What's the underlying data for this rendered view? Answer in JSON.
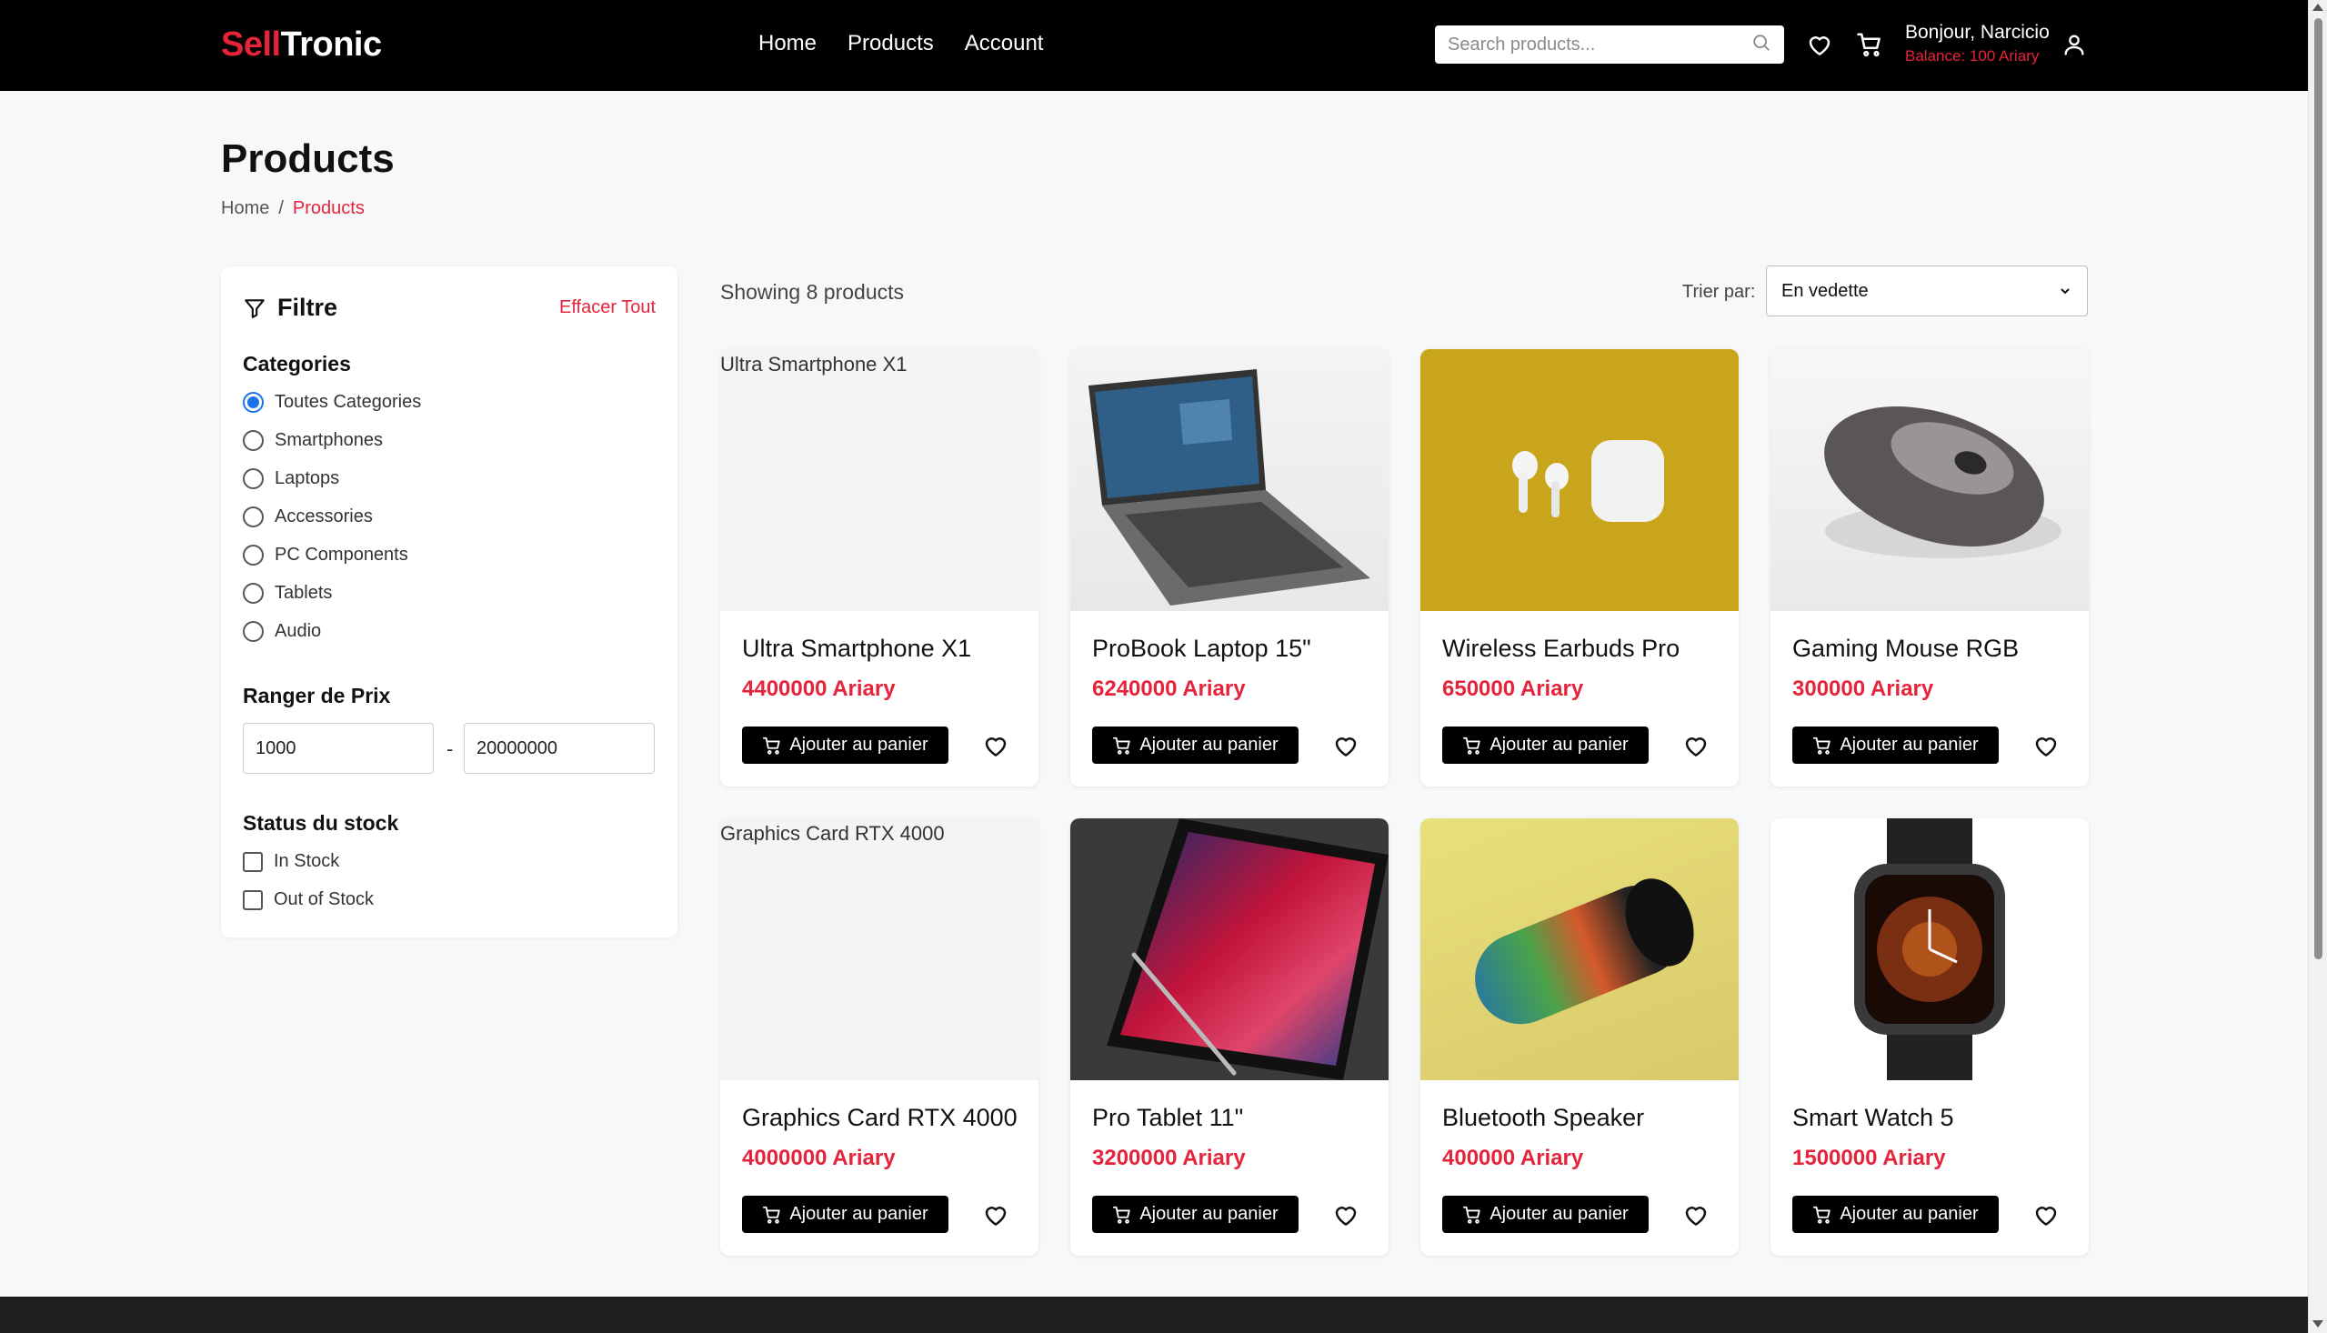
{
  "header": {
    "logo_part1": "Sell",
    "logo_part2": "Tronic",
    "nav": [
      "Home",
      "Products",
      "Account"
    ],
    "search_placeholder": "Search products...",
    "greeting": "Bonjour,",
    "user_name": "Narcicio",
    "balance": "Balance: 100 Ariary",
    "icons": [
      "search-icon",
      "heart-icon",
      "cart-icon",
      "user-icon"
    ]
  },
  "page": {
    "title": "Products",
    "breadcrumb": [
      "Home",
      "/",
      "Products"
    ]
  },
  "filters": {
    "title": "Filtre",
    "clear_all": "Effacer Tout",
    "categories_title": "Categories",
    "categories": [
      "Toutes Categories",
      "Smartphones",
      "Laptops",
      "Accessories",
      "PC Components",
      "Tablets",
      "Audio"
    ],
    "selected_category": "Toutes Categories",
    "price_title": "Ranger de Prix",
    "price_min": "1000",
    "price_max": "20000000",
    "price_separator": "-",
    "stock_title": "Status du stock",
    "stock_options": [
      "In Stock",
      "Out of Stock"
    ]
  },
  "toolbar": {
    "showing": "Showing 8 products",
    "sort_label": "Trier par:",
    "sort_value": "En vedette"
  },
  "products": [
    {
      "name": "Ultra Smartphone X1",
      "price": "4400000 Ariary",
      "image_alt": "Ultra Smartphone X1",
      "image": "broken"
    },
    {
      "name": "ProBook Laptop 15\"",
      "price": "6240000 Ariary",
      "image": "laptop"
    },
    {
      "name": "Wireless Earbuds Pro",
      "price": "650000 Ariary",
      "image": "earbuds"
    },
    {
      "name": "Gaming Mouse RGB",
      "price": "300000 Ariary",
      "image": "mouse"
    },
    {
      "name": "Graphics Card RTX 4000",
      "price": "4000000 Ariary",
      "image_alt": "Graphics Card RTX 4000",
      "image": "broken"
    },
    {
      "name": "Pro Tablet 11\"",
      "price": "3200000 Ariary",
      "image": "tablet"
    },
    {
      "name": "Bluetooth Speaker",
      "price": "400000 Ariary",
      "image": "speaker"
    },
    {
      "name": "Smart Watch 5",
      "price": "1500000 Ariary",
      "image": "watch"
    }
  ],
  "add_to_cart_label": "Ajouter au panier",
  "colors": {
    "accent": "#e5243b",
    "header_bg": "#000000",
    "radio_selected": "#1a73e8"
  }
}
